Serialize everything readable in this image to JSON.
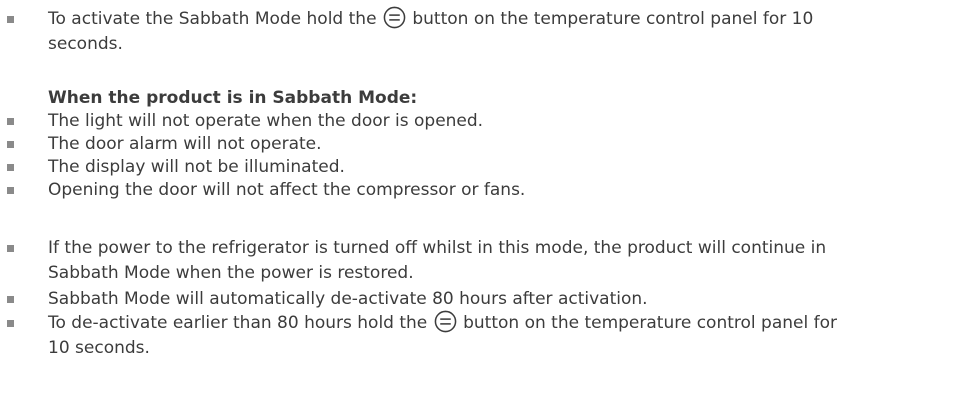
{
  "item1": {
    "before": "To activate the Sabbath Mode hold the",
    "after": "button on the temperature control panel for 10",
    "line2": "seconds."
  },
  "heading": "When the product is in Sabbath Mode:",
  "sabbath_list": [
    "The light will not operate when the door is opened.",
    "The door alarm will not operate.",
    "The display will not be illuminated.",
    "Opening the door will not affect the compressor or fans."
  ],
  "item_power": {
    "line1": "If the power to the refrigerator is turned off whilst in this mode, the product will continue in",
    "line2": "Sabbath Mode when the power is restored."
  },
  "item_auto": "Sabbath Mode will automatically de-activate 80 hours after activation.",
  "item_deactivate": {
    "before": "To de-activate earlier than 80 hours hold the",
    "after": "button on the temperature control panel for",
    "line2": "10 seconds."
  },
  "icons": {
    "button_symbol": "equals-circle-icon"
  },
  "colors": {
    "text": "#3c3c3c",
    "bullet": "#8a8a8a"
  }
}
